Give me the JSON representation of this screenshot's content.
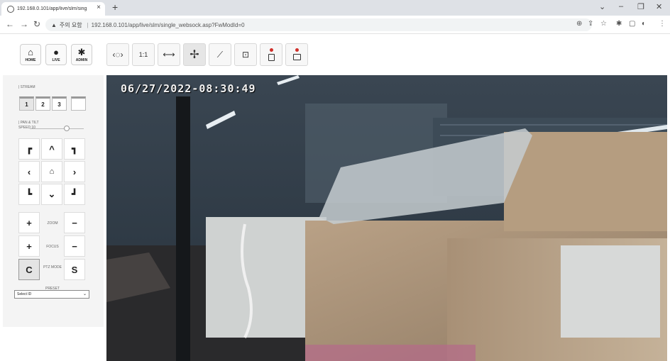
{
  "browser": {
    "tab_title": "192.168.0.101/app/live/slm/sing",
    "insecure_label": "주의 요함",
    "url": "192.168.0.101/app/live/slm/single_websock.asp?FwModId=0"
  },
  "toolbar": {
    "home_label": "HOME",
    "live_label": "LIVE",
    "admin_label": "ADMIN",
    "one_to_one_label": "1:1"
  },
  "panel": {
    "stream_label": "| STREAM",
    "stream_buttons": [
      "1",
      "2",
      "3",
      ""
    ],
    "pantilt_label": "| PAN & TILT",
    "speed_label": "SPEED 10",
    "speed_value": 0.7,
    "zoom_label": "ZOOM",
    "focus_label": "FOCUS",
    "ptz_mode_label": "PTZ MODE",
    "c_label": "C",
    "s_label": "S",
    "preset_label": "PRESET",
    "preset_value": "Select ID"
  },
  "video": {
    "timestamp": "06/27/2022-08:30:49"
  },
  "colors": {
    "record_dot": "#d0302a",
    "panel_bg": "#f4f4f4"
  }
}
